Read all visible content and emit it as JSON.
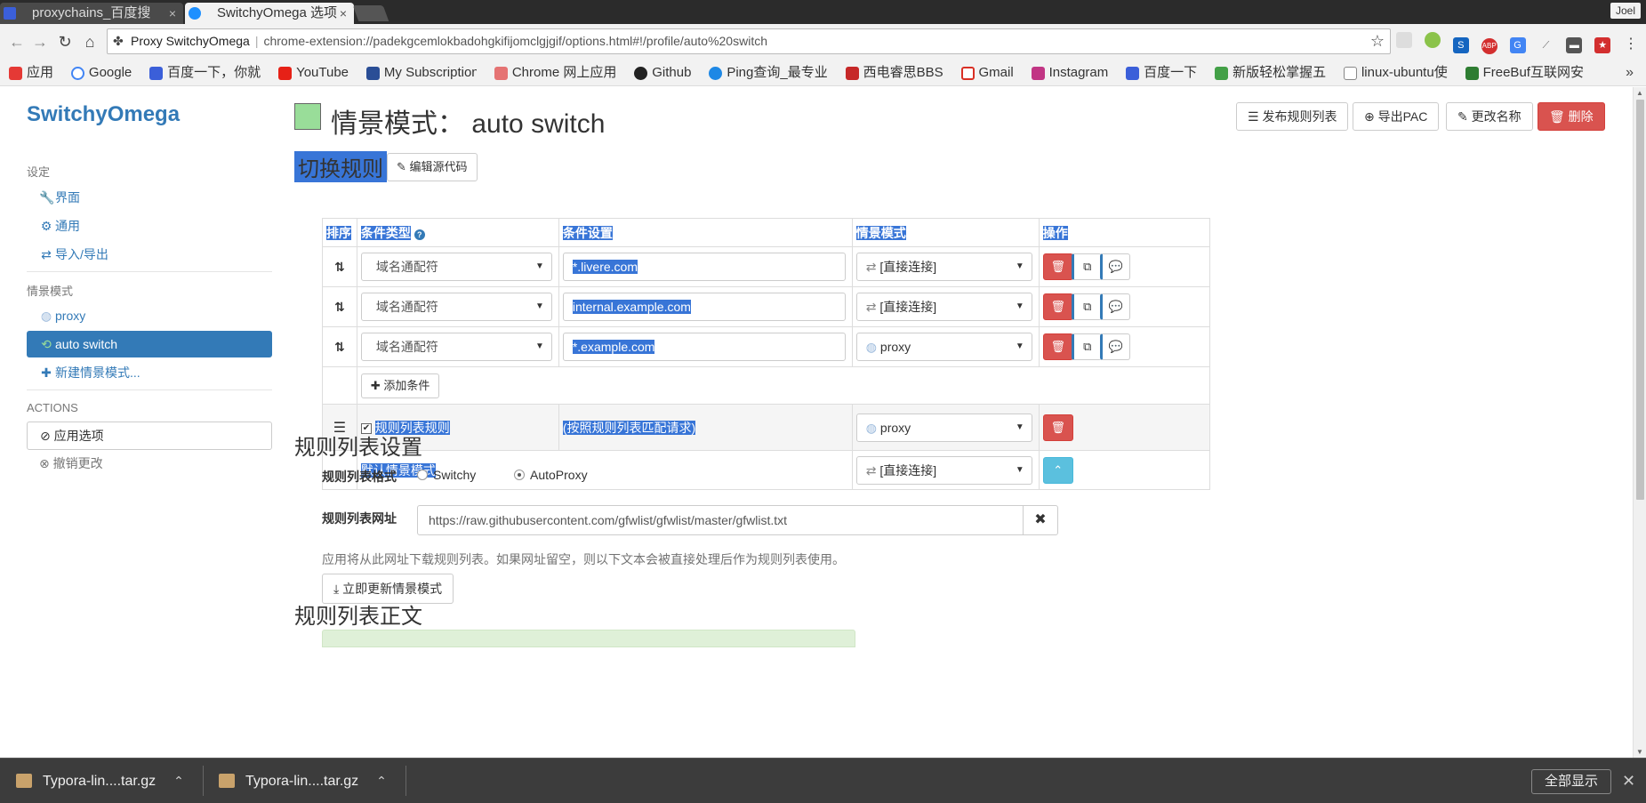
{
  "browser": {
    "tabs": [
      {
        "title": "proxychains_百度搜",
        "close": "×"
      },
      {
        "title": "SwitchyOmega 选项",
        "close": "×"
      }
    ],
    "user": "Joel",
    "omnibox": {
      "site": "Proxy SwitchyOmega",
      "url": "chrome-extension://padekgcemlokbadohgkifijomclgjgif/options.html#!/profile/auto%20switch"
    },
    "bookmarks": [
      "应用",
      "Google",
      "百度一下，你就",
      "YouTube",
      "My Subscription",
      "Chrome 网上应用",
      "Github",
      "Ping查询_最专业",
      "西电睿思BBS",
      "Gmail",
      "Instagram",
      "百度一下",
      "新版轻松掌握五",
      "linux-ubuntu使",
      "FreeBuf互联网安"
    ],
    "bookmarks_more": "»"
  },
  "sidebar": {
    "brand": "SwitchyOmega",
    "settings_header": "设定",
    "settings_items": [
      "界面",
      "通用",
      "导入/导出"
    ],
    "profiles_header": "情景模式",
    "profiles": [
      "proxy",
      "auto switch"
    ],
    "new_profile": "新建情景模式...",
    "actions_header": "ACTIONS",
    "apply": "应用选项",
    "discard": "撤销更改"
  },
  "header": {
    "title_prefix": "情景模式：",
    "title_name": "auto switch",
    "swatch_color": "#99dd99",
    "buttons": {
      "publish": "发布规则列表",
      "export_pac": "导出PAC",
      "rename": "更改名称",
      "delete": "删除"
    }
  },
  "switch_rules": {
    "title": "切换规则",
    "edit_source": "编辑源代码",
    "columns": [
      "排序",
      "条件类型",
      "条件设置",
      "情景模式",
      "操作"
    ],
    "rules": [
      {
        "type": "域名通配符",
        "pattern": "*.livere.com",
        "profile": "[直接连接]"
      },
      {
        "type": "域名通配符",
        "pattern": "internal.example.com",
        "profile": "[直接连接]"
      },
      {
        "type": "域名通配符",
        "pattern": "*.example.com",
        "profile": "proxy"
      }
    ],
    "add_condition": "添加条件",
    "rule_list_row": {
      "label": "规则列表规则",
      "desc": "(按照规则列表匹配请求)",
      "profile": "proxy"
    },
    "default_row": {
      "label": "默认情景模式",
      "profile": "[直接连接]"
    }
  },
  "rule_list_settings": {
    "title": "规则列表设置",
    "format_label": "规则列表格式",
    "formats": [
      "Switchy",
      "AutoProxy"
    ],
    "selected_format": "AutoProxy",
    "url_label": "规则列表网址",
    "url": "https://raw.githubusercontent.com/gfwlist/gfwlist/master/gfwlist.txt",
    "help": "应用将从此网址下载规则列表。如果网址留空，则以下文本会被直接处理后作为规则列表使用。",
    "update_now": "立即更新情景模式"
  },
  "rule_list_text": {
    "title": "规则列表正文"
  },
  "downloads": {
    "items": [
      "Typora-lin....tar.gz",
      "Typora-lin....tar.gz"
    ],
    "show_all": "全部显示"
  },
  "colors": {
    "accent": "#337ab7",
    "danger": "#d9534f",
    "selection": "#3875d7",
    "info": "#5bc0de"
  }
}
